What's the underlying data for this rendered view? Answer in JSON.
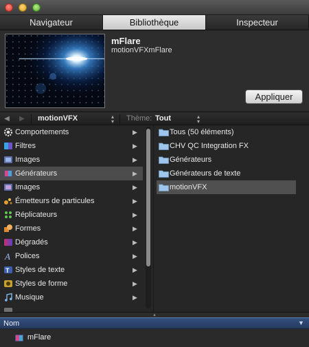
{
  "tabs": [
    {
      "label": "Navigateur"
    },
    {
      "label": "Bibliothèque"
    },
    {
      "label": "Inspecteur"
    }
  ],
  "preview": {
    "title": "mFlare",
    "subtitle": "motionVFXmFlare",
    "apply_label": "Appliquer"
  },
  "toolbar": {
    "source": "motionVFX",
    "theme_label": "Thème:",
    "theme_value": "Tout"
  },
  "categories": [
    {
      "label": "Comportements",
      "icon": "gear-icon"
    },
    {
      "label": "Filtres",
      "icon": "filters-icon"
    },
    {
      "label": "Images",
      "icon": "film-icon"
    },
    {
      "label": "Générateurs",
      "icon": "generators-icon",
      "selected": true
    },
    {
      "label": "Images",
      "icon": "film-icon"
    },
    {
      "label": "Émetteurs de particules",
      "icon": "particle-emitter-icon"
    },
    {
      "label": "Réplicateurs",
      "icon": "replicator-icon"
    },
    {
      "label": "Formes",
      "icon": "shapes-icon"
    },
    {
      "label": "Dégradés",
      "icon": "gradient-icon"
    },
    {
      "label": "Polices",
      "icon": "font-icon"
    },
    {
      "label": "Styles de texte",
      "icon": "text-style-icon"
    },
    {
      "label": "Styles de forme",
      "icon": "shape-style-icon"
    },
    {
      "label": "Musique",
      "icon": "music-icon"
    }
  ],
  "folders": [
    {
      "label": "Tous (50 éléments)"
    },
    {
      "label": "CHV QC Integration FX"
    },
    {
      "label": "Générateurs"
    },
    {
      "label": "Générateurs de texte"
    },
    {
      "label": "motionVFX",
      "selected": true
    }
  ],
  "list": {
    "header": "Nom",
    "rows": [
      {
        "label": "mFlare",
        "icon": "generator-file-icon"
      }
    ]
  },
  "colors": {
    "selection": "#505050",
    "list_header": "#2f4a76",
    "apply_button": "#e3e3e3"
  }
}
